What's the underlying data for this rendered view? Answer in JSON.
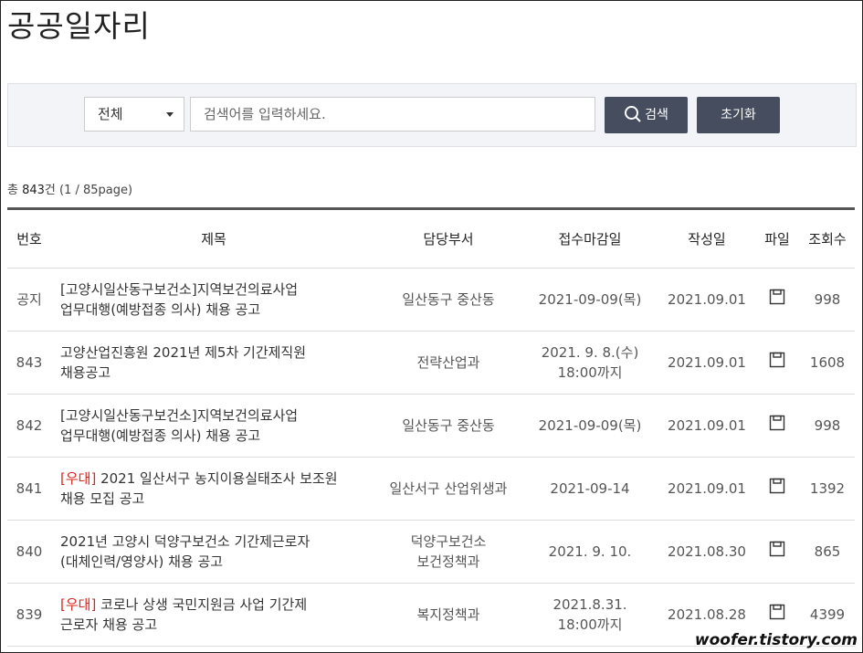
{
  "page_title": "공공일자리",
  "search": {
    "category": "전체",
    "placeholder": "검색어를 입력하세요.",
    "search_button": "검색",
    "reset_button": "초기화"
  },
  "count": {
    "prefix": "총 ",
    "total": "843",
    "suffix": "건 (1 / 85page)"
  },
  "table": {
    "headers": {
      "no": "번호",
      "title": "제목",
      "dept": "담당부서",
      "deadline": "접수마감일",
      "date": "작성일",
      "file": "파일",
      "views": "조회수"
    },
    "rows": [
      {
        "no": "공지",
        "tag": "",
        "title1": "[고양시일산동구보건소]지역보건의료사업",
        "title2": "업무대행(예방접종 의사) 채용 공고",
        "dept1": "일산동구 중산동",
        "dept2": "",
        "deadline1": "2021-09-09(목)",
        "deadline2": "",
        "date": "2021.09.01",
        "views": "998"
      },
      {
        "no": "843",
        "tag": "",
        "title1": "고양산업진흥원 2021년 제5차 기간제직원",
        "title2": "채용공고",
        "dept1": "전략산업과",
        "dept2": "",
        "deadline1": "2021. 9. 8.(수)",
        "deadline2": "18:00까지",
        "date": "2021.09.01",
        "views": "1608"
      },
      {
        "no": "842",
        "tag": "",
        "title1": "[고양시일산동구보건소]지역보건의료사업",
        "title2": "업무대행(예방접종 의사) 채용 공고",
        "dept1": "일산동구 중산동",
        "dept2": "",
        "deadline1": "2021-09-09(목)",
        "deadline2": "",
        "date": "2021.09.01",
        "views": "998"
      },
      {
        "no": "841",
        "tag": "[우대]",
        "title1": " 2021 일산서구 농지이용실태조사 보조원",
        "title2": "채용 모집 공고",
        "dept1": "일산서구 산업위생과",
        "dept2": "",
        "deadline1": "2021-09-14",
        "deadline2": "",
        "date": "2021.09.01",
        "views": "1392"
      },
      {
        "no": "840",
        "tag": "",
        "title1": "2021년 고양시 덕양구보건소 기간제근로자",
        "title2": "(대체인력/영양사) 채용 공고",
        "dept1": "덕양구보건소",
        "dept2": "보건정책과",
        "deadline1": "2021. 9. 10.",
        "deadline2": "",
        "date": "2021.08.30",
        "views": "865"
      },
      {
        "no": "839",
        "tag": "[우대]",
        "title1": " 코로나 상생 국민지원금 사업 기간제",
        "title2": "근로자 채용 공고",
        "dept1": "복지정책과",
        "dept2": "",
        "deadline1": "2021.8.31.",
        "deadline2": "18:00까지",
        "date": "2021.08.28",
        "views": "4399"
      }
    ]
  },
  "watermark": "woofer.tistory.com"
}
